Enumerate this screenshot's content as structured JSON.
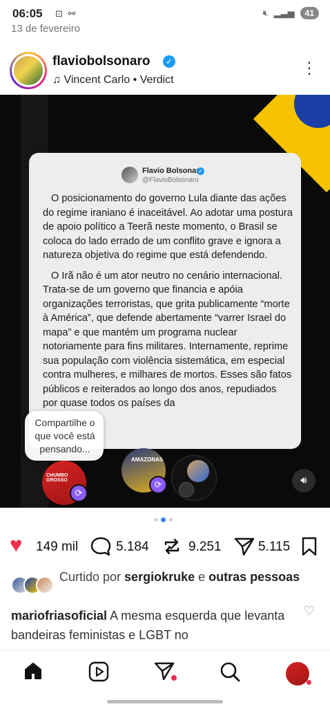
{
  "status_bar": {
    "time": "06:05",
    "date": "13 de fevereiro",
    "battery": "41"
  },
  "post_header": {
    "username": "flaviobolsonaro",
    "music": "Vincent Carlo • Verdict"
  },
  "tweet_card": {
    "name": "Flavio Bolsonaro",
    "handle": "@FlavioBolsonaro",
    "paragraphs": [
      "O posicionamento do governo Lula diante das ações do regime iraniano é inaceitável. Ao adotar uma postura de apoio político a Teerã neste momento, o Brasil se coloca do lado errado de um conflito grave e ignora a natureza objetiva do regime que está defendendo.",
      "O Irã não é um ator neutro no cenário internacional. Trata-se de um governo que financia e apóia organizações terroristas, que grita publicamente “morte à América”, que defende abertamente “varrer Israel do mapa” e que mantém um programa nuclear notoriamente para fins militares. Internamente, reprime sua população com violência sistemática, em especial contra mulheres, e milhares de mortos. Esses são fatos públicos e reiterados ao longo dos anos, repudiados por quase todos os países da"
    ]
  },
  "tooltip": "Compartilhe o que você está pensando...",
  "overlay_circles": {
    "c1_label": "CHUMBO GROSSO",
    "c2_label": "AMAZONAS"
  },
  "actions": {
    "likes": "149 mil",
    "comments": "5.184",
    "reposts": "9.251",
    "shares": "5.115"
  },
  "liked_by": {
    "prefix": "Curtido por ",
    "user": "sergiokruke",
    "middle": " e ",
    "suffix": "outras pessoas"
  },
  "caption": {
    "user": "mariofriasoficial",
    "text": " A mesma esquerda que levanta bandeiras feministas e LGBT no"
  },
  "icons": {
    "home": "home-icon",
    "reels": "reels-icon",
    "direct": "direct-icon",
    "search": "search-icon"
  },
  "colors": {
    "like": "#ef2f50",
    "verified": "#1d9bf0",
    "carousel_active": "#3b82f6"
  }
}
